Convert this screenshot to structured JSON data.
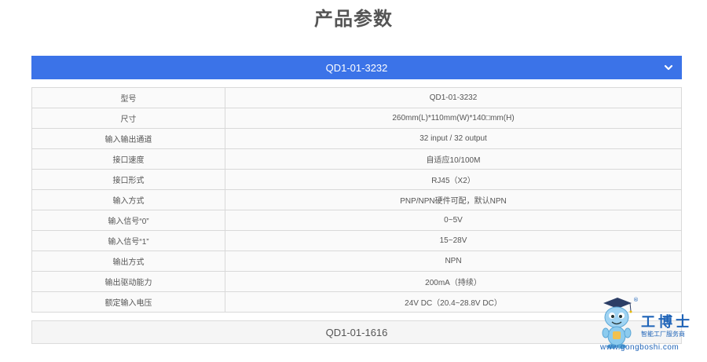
{
  "page_title": "产品参数",
  "accordion_open": {
    "title": "QD1-01-3232",
    "chevron": "chevron-down-icon"
  },
  "specs": [
    {
      "label": "型号",
      "value": "QD1-01-3232"
    },
    {
      "label": "尺寸",
      "value": "260mm(L)*110mm(W)*140□mm(H)"
    },
    {
      "label": "输入输出通道",
      "value": "32 input / 32 output"
    },
    {
      "label": "接口速度",
      "value": "自适应10/100M"
    },
    {
      "label": "接口形式",
      "value": "RJ45（X2）"
    },
    {
      "label": "输入方式",
      "value": "PNP/NPN硬件可配，默认NPN"
    },
    {
      "label": "输入信号“0”",
      "value": "0~5V"
    },
    {
      "label": "输入信号“1”",
      "value": "15~28V"
    },
    {
      "label": "输出方式",
      "value": "NPN"
    },
    {
      "label": "输出驱动能力",
      "value": "200mA（持续）"
    },
    {
      "label": "额定输入电压",
      "value": "24V DC（20.4~28.8V DC）"
    }
  ],
  "accordion_closed": {
    "title": "QD1-01-1616"
  },
  "logo": {
    "brand": "工博士",
    "reg": "®",
    "tagline": "智能工厂服务商",
    "url": "www.gongboshi.com"
  },
  "colors": {
    "accent": "#3b73e8",
    "brand": "#1f64b8"
  }
}
